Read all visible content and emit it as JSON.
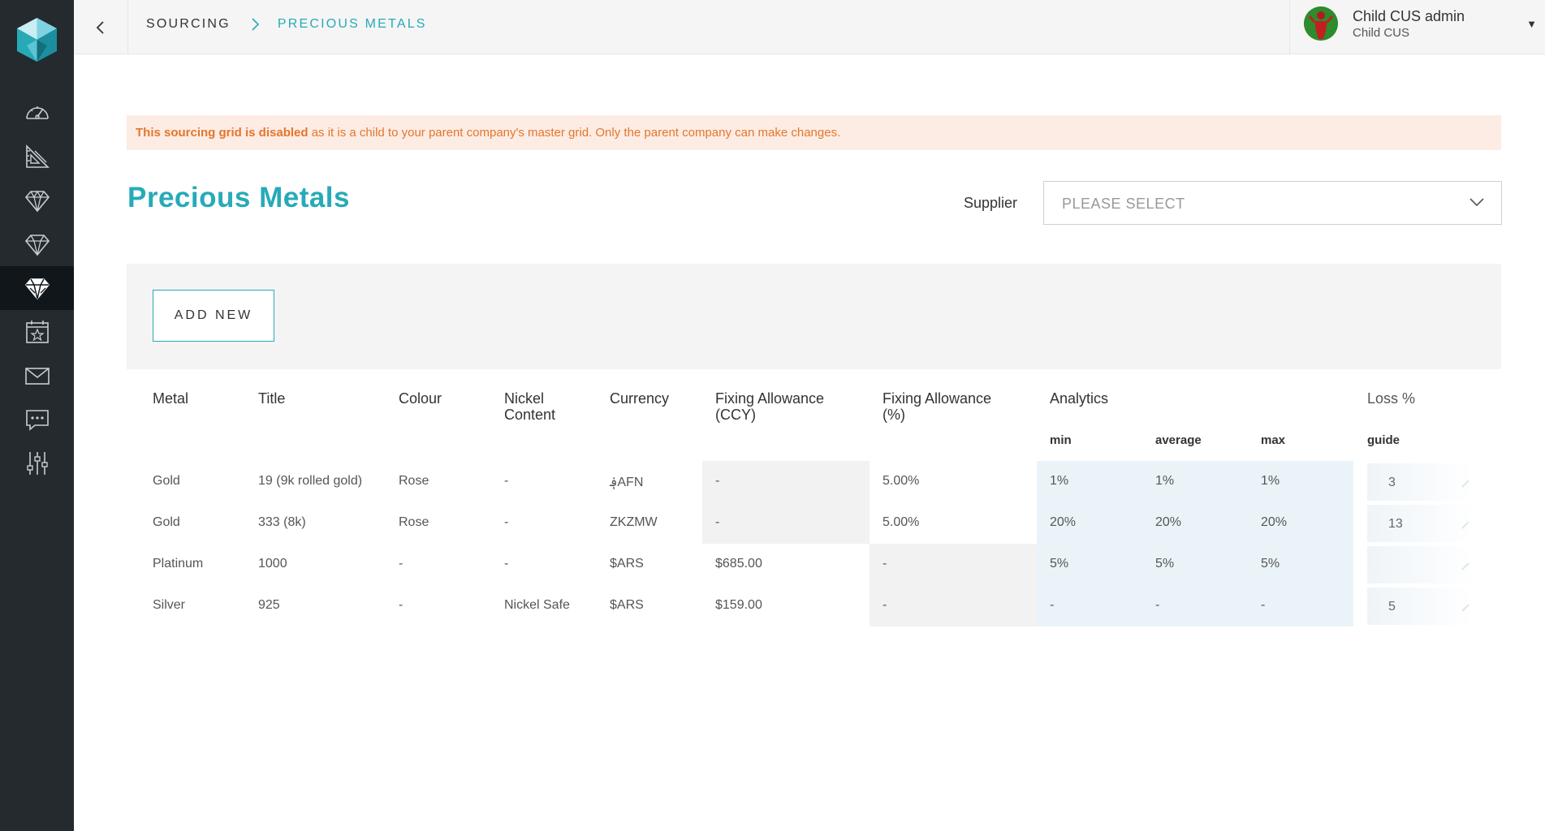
{
  "icons": {
    "logo": "cube-logo-icon",
    "nav": [
      "speedometer-icon",
      "ruler-icon",
      "gem-outline-icon",
      "diamond-icon",
      "precious-metals-icon",
      "calendar-star-icon",
      "mail-icon",
      "chat-icon",
      "sliders-icon"
    ]
  },
  "header": {
    "breadcrumb": {
      "parent": "SOURCING",
      "current": "PRECIOUS METALS"
    },
    "user": {
      "name": "Child CUS admin",
      "org": "Child CUS",
      "caret": "▼"
    }
  },
  "alert": {
    "bold": "This sourcing grid is disabled",
    "rest": " as it is a child to your parent company's master grid. Only the parent company can make changes."
  },
  "page": {
    "title": "Precious Metals"
  },
  "supplier": {
    "label": "Supplier",
    "value": "PLEASE SELECT"
  },
  "toolbar": {
    "add_label": "ADD NEW"
  },
  "table": {
    "headers": {
      "metal": "Metal",
      "title": "Title",
      "colour": "Colour",
      "nickel_1": "Nickel",
      "nickel_2": "Content",
      "currency": "Currency",
      "fix_ccy_1": "Fixing Allowance",
      "fix_ccy_2": "(CCY)",
      "fix_pct_1": "Fixing Allowance",
      "fix_pct_2": "(%)",
      "analytics": "Analytics",
      "loss": "Loss %"
    },
    "subheaders": {
      "min": "min",
      "average": "average",
      "max": "max",
      "guide": "guide"
    },
    "rows": [
      {
        "metal": "Gold",
        "title": "19 (9k rolled gold)",
        "colour": "Rose",
        "nickel": "-",
        "currency": "؋AFN",
        "fix_ccy": "-",
        "fix_pct": "5.00%",
        "min": "1%",
        "avg": "1%",
        "max": "1%",
        "guide": "3"
      },
      {
        "metal": "Gold",
        "title": "333 (8k)",
        "colour": "Rose",
        "nickel": "-",
        "currency": "ZKZMW",
        "fix_ccy": "-",
        "fix_pct": "5.00%",
        "min": "20%",
        "avg": "20%",
        "max": "20%",
        "guide": "13"
      },
      {
        "metal": "Platinum",
        "title": "1000",
        "colour": "-",
        "nickel": "-",
        "currency": "$ARS",
        "fix_ccy": "$685.00",
        "fix_pct": "-",
        "min": "5%",
        "avg": "5%",
        "max": "5%",
        "guide": ""
      },
      {
        "metal": "Silver",
        "title": "925",
        "colour": "-",
        "nickel": "Nickel Safe",
        "currency": "$ARS",
        "fix_ccy": "$159.00",
        "fix_pct": "-",
        "min": "-",
        "avg": "-",
        "max": "-",
        "guide": "5"
      }
    ]
  }
}
